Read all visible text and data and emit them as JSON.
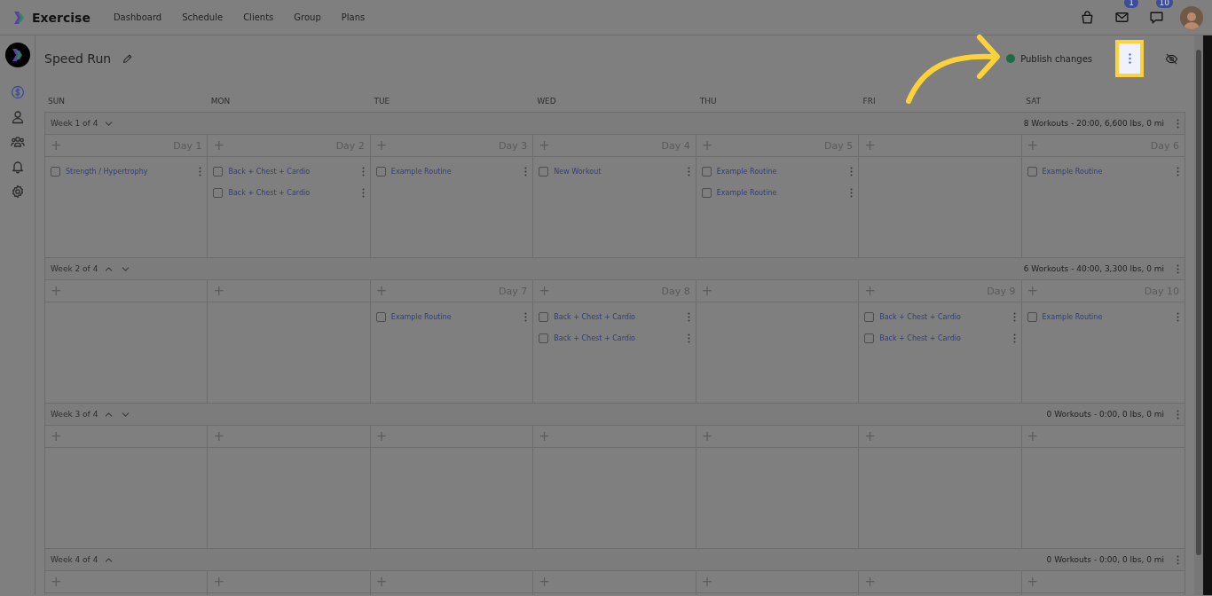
{
  "app": {
    "name": "Exercise"
  },
  "nav": [
    "Dashboard",
    "Schedule",
    "Clients",
    "Group",
    "Plans"
  ],
  "header_icons": [
    {
      "kind": "bag"
    },
    {
      "kind": "mail",
      "badge": "1"
    },
    {
      "kind": "chat",
      "badge": "10"
    }
  ],
  "sidebar": [
    {
      "kind": "dollar",
      "selected": true
    },
    {
      "kind": "person",
      "selected": false
    },
    {
      "kind": "group",
      "selected": false
    },
    {
      "kind": "bell",
      "selected": false
    },
    {
      "kind": "gear",
      "selected": false
    }
  ],
  "plan": {
    "title": "Speed Run",
    "publish_label": "Publish changes"
  },
  "weekdays": [
    "SUN",
    "MON",
    "TUE",
    "WED",
    "THU",
    "FRI",
    "SAT"
  ],
  "weeks": [
    {
      "label": "Week 1 of 4",
      "up": false,
      "down": true,
      "summary": "8 Workouts - 20:00, 6,600 lbs, 0 mi",
      "days": [
        {
          "add": "+",
          "day": "Day 1",
          "workouts": [
            {
              "name": "Strength / Hypertrophy",
              "checked": false
            }
          ]
        },
        {
          "add": "+",
          "day": "Day 2",
          "workouts": [
            {
              "name": "Back + Chest + Cardio",
              "checked": false
            },
            {
              "name": "Back + Chest + Cardio",
              "checked": false
            }
          ]
        },
        {
          "add": "+",
          "day": "Day 3",
          "workouts": [
            {
              "name": "Example Routine",
              "checked": false
            }
          ]
        },
        {
          "add": "+",
          "day": "Day 4",
          "workouts": [
            {
              "name": "New Workout",
              "checked": false
            }
          ]
        },
        {
          "add": "+",
          "day": "Day 5",
          "workouts": [
            {
              "name": "Example Routine",
              "checked": false
            },
            {
              "name": "Example Routine",
              "checked": false
            }
          ]
        },
        {
          "add": "+"
        },
        {
          "add": "+",
          "day": "Day 6",
          "workouts": [
            {
              "name": "Example Routine",
              "checked": false
            }
          ]
        }
      ]
    },
    {
      "label": "Week 2 of 4",
      "up": true,
      "down": true,
      "summary": "6 Workouts - 40:00, 3,300 lbs, 0 mi",
      "days": [
        {
          "add": "+"
        },
        {
          "add": "+"
        },
        {
          "add": "+",
          "day": "Day 7",
          "workouts": [
            {
              "name": "Example Routine",
              "checked": false
            }
          ]
        },
        {
          "add": "+",
          "day": "Day 8",
          "workouts": [
            {
              "name": "Back + Chest + Cardio",
              "checked": false
            },
            {
              "name": "Back + Chest + Cardio",
              "checked": false
            }
          ]
        },
        {
          "add": "+"
        },
        {
          "add": "+",
          "day": "Day 9",
          "workouts": [
            {
              "name": "Back + Chest + Cardio",
              "checked": false
            },
            {
              "name": "Back + Chest + Cardio",
              "checked": false
            }
          ]
        },
        {
          "add": "+",
          "day": "Day 10",
          "workouts": [
            {
              "name": "Example Routine",
              "checked": false
            }
          ]
        }
      ]
    },
    {
      "label": "Week 3 of 4",
      "up": true,
      "down": true,
      "summary": "0 Workouts - 0:00, 0 lbs, 0 mi",
      "days": [
        {
          "add": "+"
        },
        {
          "add": "+"
        },
        {
          "add": "+"
        },
        {
          "add": "+"
        },
        {
          "add": "+"
        },
        {
          "add": "+"
        },
        {
          "add": "+"
        }
      ]
    },
    {
      "label": "Week 4 of 4",
      "up": true,
      "down": false,
      "summary": "0 Workouts - 0:00, 0 lbs, 0 mi",
      "days": [
        {
          "add": "+"
        },
        {
          "add": "+"
        },
        {
          "add": "+"
        },
        {
          "add": "+"
        },
        {
          "add": "+"
        },
        {
          "add": "+"
        },
        {
          "add": "+"
        }
      ]
    }
  ]
}
